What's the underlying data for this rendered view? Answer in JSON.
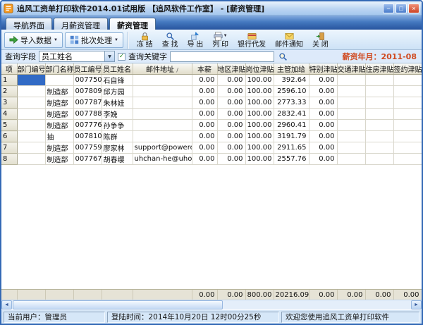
{
  "window": {
    "title": "追风工资单打印软件2014.01试用版 【追风软件工作室】 - [薪资管理]"
  },
  "icons": {
    "minimize": "−",
    "maximize": "□",
    "close": "×",
    "dropdown": "▼",
    "scroll_left": "◄",
    "scroll_right": "►",
    "check": "✓",
    "sort": "/"
  },
  "tabs": [
    {
      "label": "导航界面"
    },
    {
      "label": "月薪资管理"
    },
    {
      "label": "薪资管理"
    }
  ],
  "toolbar": {
    "import_label": "导入数据",
    "batch_label": "批次处理",
    "freeze_label": "冻 结",
    "find_label": "查 找",
    "export_label": "导 出",
    "print_label": "列 印",
    "bank_label": "银行代发",
    "mail_label": "邮件通知",
    "close_label": "关 闭"
  },
  "query": {
    "field_label": "查询字段",
    "field_value": "员工姓名",
    "keyword_label": "查询关键字",
    "keyword_value": "",
    "salary_month_label": "薪资年月：",
    "salary_month_value": "2011-08"
  },
  "colors": {
    "salary_month_text": "#d04a20",
    "selected_cell": "#316ac5",
    "titlebar": "#bcd5f2",
    "tabbar": "#27549e"
  },
  "grid": {
    "columns": [
      "项",
      "部门编号",
      "部门名称",
      "员工编号",
      "员工姓名",
      "邮件地址",
      "本薪",
      "地区津贴",
      "岗位津贴",
      "主管加给",
      "特别津贴",
      "交通津贴",
      "住房津贴",
      "签约津贴"
    ],
    "selected_cell": {
      "row": 0,
      "col": 1
    },
    "rows": [
      [
        "1",
        "",
        "",
        "007750",
        "石自锋",
        "",
        "0.00",
        "0.00",
        "100.00",
        "392.64",
        "0.00",
        "",
        "",
        ""
      ],
      [
        "2",
        "",
        "制造部",
        "007809",
        "邱方园",
        "",
        "0.00",
        "0.00",
        "100.00",
        "2596.10",
        "0.00",
        "",
        "",
        ""
      ],
      [
        "3",
        "",
        "制造部",
        "007787",
        "朱林娃",
        "",
        "0.00",
        "0.00",
        "100.00",
        "2773.33",
        "0.00",
        "",
        "",
        ""
      ],
      [
        "4",
        "",
        "制造部",
        "007788",
        "李娩",
        "",
        "0.00",
        "0.00",
        "100.00",
        "2832.41",
        "0.00",
        "",
        "",
        ""
      ],
      [
        "5",
        "",
        "制造部",
        "007776",
        "孙争争",
        "",
        "0.00",
        "0.00",
        "100.00",
        "2960.41",
        "0.00",
        "",
        "",
        ""
      ],
      [
        "6",
        "",
        "抽",
        "007810",
        "陈群",
        "",
        "0.00",
        "0.00",
        "100.00",
        "3191.79",
        "0.00",
        "",
        "",
        ""
      ],
      [
        "7",
        "",
        "制造部",
        "007759",
        "廖家林",
        "support@poweroffice",
        "0.00",
        "0.00",
        "100.00",
        "2911.65",
        "0.00",
        "",
        "",
        ""
      ],
      [
        "8",
        "",
        "制造部",
        "007767",
        "胡春缨",
        "uhchan-he@uhos.cn",
        "0.00",
        "0.00",
        "100.00",
        "2557.76",
        "0.00",
        "",
        "",
        ""
      ]
    ],
    "summary": [
      "",
      "",
      "",
      "",
      "",
      "",
      "0.00",
      "0.00",
      "800.00",
      "20216.09",
      "0.00",
      "0.00",
      "0.00",
      "0.00"
    ]
  },
  "statusbar": {
    "user": "当前用户：管理员",
    "login_time": "登陆时间：2014年10月20日 12时00分25秒",
    "welcome": "欢迎您使用追风工资单打印软件"
  }
}
